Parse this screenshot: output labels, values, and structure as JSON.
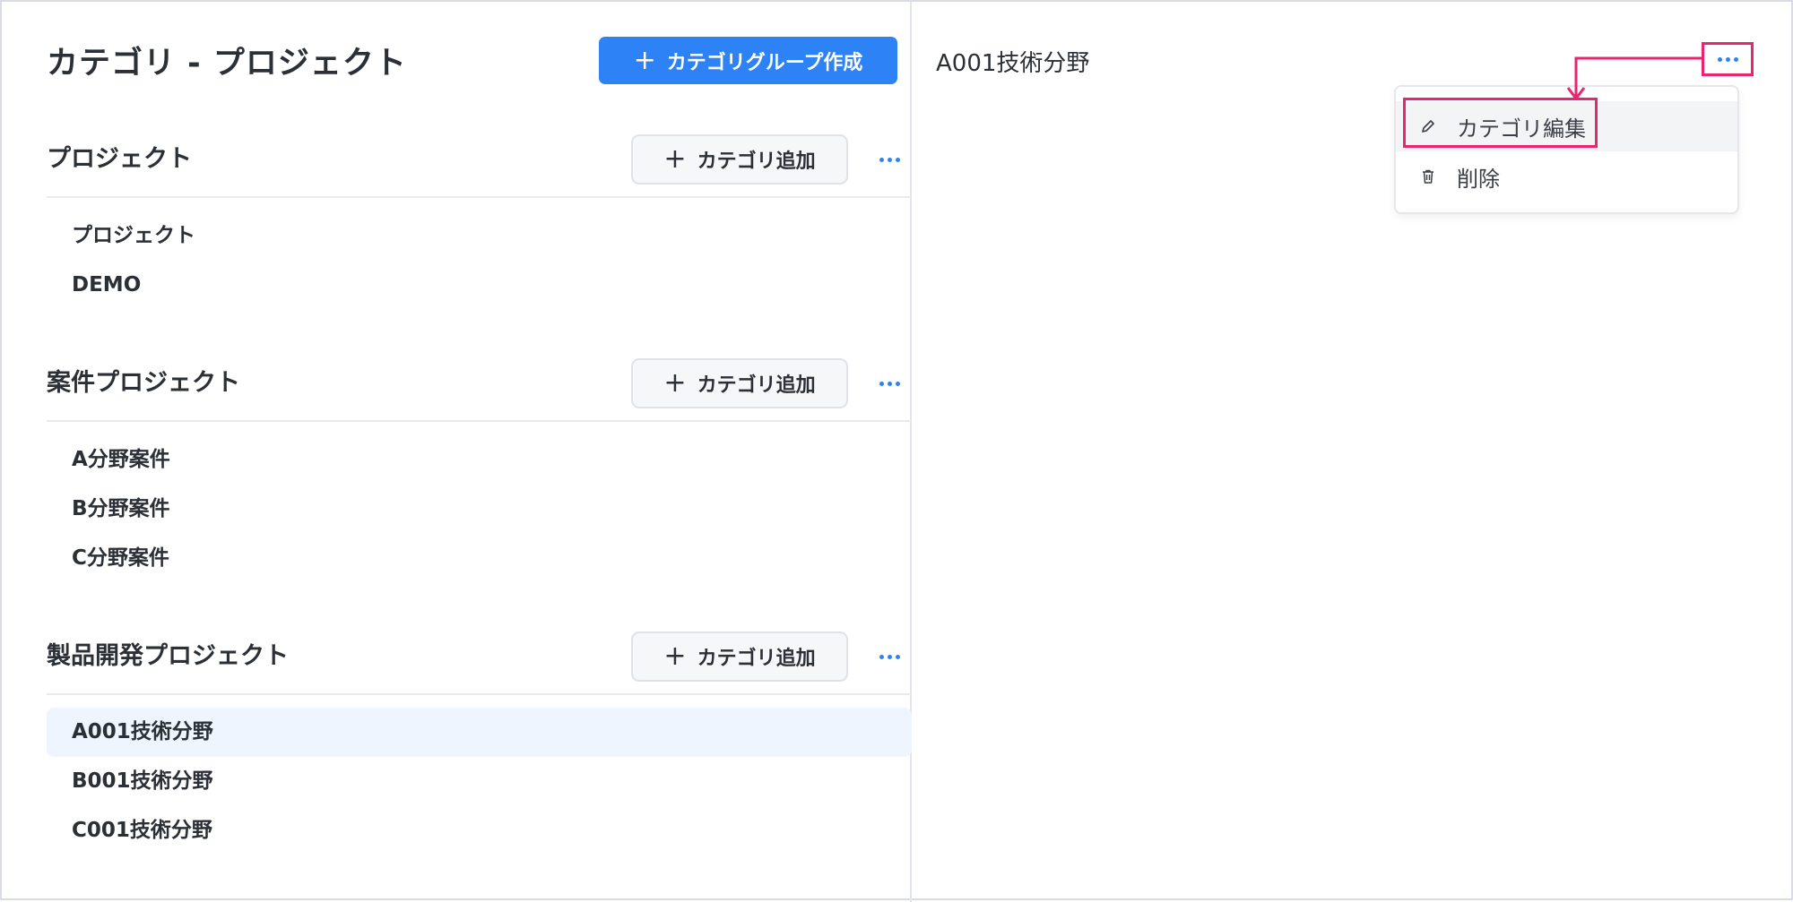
{
  "header": {
    "title": "カテゴリ - プロジェクト",
    "create_group_label": "カテゴリグループ作成"
  },
  "groups": [
    {
      "title": "プロジェクト",
      "add_label": "カテゴリ追加",
      "items": [
        "プロジェクト",
        "DEMO"
      ]
    },
    {
      "title": "案件プロジェクト",
      "add_label": "カテゴリ追加",
      "items": [
        "A分野案件",
        "B分野案件",
        "C分野案件"
      ]
    },
    {
      "title": "製品開発プロジェクト",
      "add_label": "カテゴリ追加",
      "items": [
        "A001技術分野",
        "B001技術分野",
        "C001技術分野"
      ]
    }
  ],
  "detail": {
    "title": "A001技術分野"
  },
  "context_menu": {
    "items": [
      {
        "label": "カテゴリ編集",
        "icon": "pencil-icon"
      },
      {
        "label": "削除",
        "icon": "trash-icon"
      }
    ]
  },
  "colors": {
    "accent": "#2d83f5",
    "annotation": "#e8256e",
    "selected_row": "#eef5fe"
  }
}
